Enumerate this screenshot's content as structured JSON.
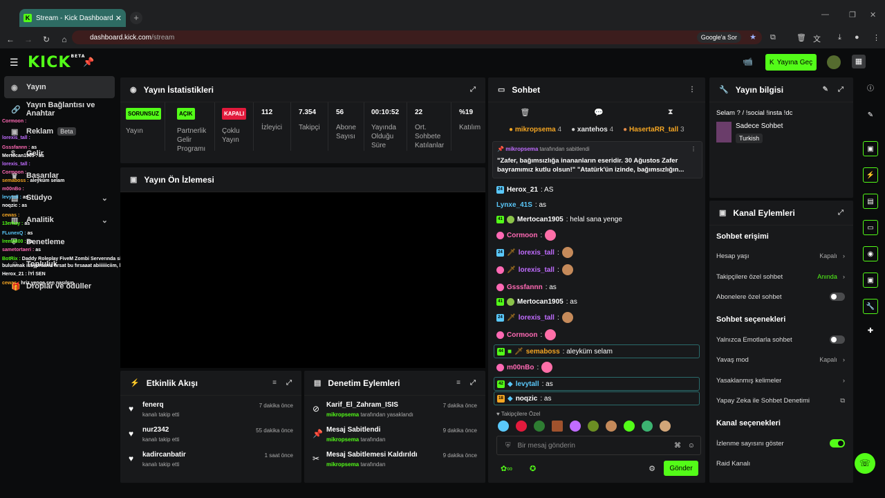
{
  "browser": {
    "tab_title": "Stream - Kick Dashboard",
    "url_host": "dashboard.kick.com",
    "url_path": "/stream",
    "ask_google": "Google'a Sor"
  },
  "top": {
    "logo": "KICK",
    "logo_sup": "BETA",
    "go_live": "Yayına Geç"
  },
  "sidebar": {
    "items": [
      {
        "label": "Yayın"
      },
      {
        "label": "Yayın Bağlantısı ve Anahtar"
      },
      {
        "label": "Reklam",
        "badge": "Beta"
      },
      {
        "label": "Gelir"
      },
      {
        "label": "Başarılar"
      },
      {
        "label": "Stüdyo"
      },
      {
        "label": "Analitik"
      },
      {
        "label": "Denetleme"
      },
      {
        "label": "Topluluk"
      },
      {
        "label": "Droplar ve ödüller"
      }
    ]
  },
  "overlay_chat": [
    {
      "u": "Cormoon :",
      "m": ""
    },
    {
      "u": "lorexis_tall :",
      "m": ""
    },
    {
      "u": "Gsssfannn :",
      "m": "as"
    },
    {
      "u": "Mertocan1905 :",
      "m": "as"
    },
    {
      "u": "lorexis_tall :",
      "m": ""
    },
    {
      "u": "Cormoon :",
      "m": ""
    },
    {
      "u": "semaboss :",
      "m": "aleyküm selam"
    },
    {
      "u": "m00nBo :",
      "m": ""
    },
    {
      "u": "levytall :",
      "m": "as"
    },
    {
      "u": "noqzic :",
      "m": "as"
    },
    {
      "u": "cewas :",
      "m": ""
    },
    {
      "u": "13erkay :",
      "m": "as"
    },
    {
      "u": "FLunexQ :",
      "m": "as"
    },
    {
      "u": "lrem8800 :",
      "m": "as"
    },
    {
      "u": "sametortaeri :",
      "m": "as"
    },
    {
      "u": "BotRix :",
      "m": "Daddy Roleplay FiveM Zombi Serverında sizlerde bizlerle birlikte rol yapma deneyiminde"
    },
    {
      "u": "",
      "m": "bulunmak istiyorsanız fırsat bu fırsaaat abiiiiiiciim, hemen başvurularr açıktır ! https://discord.gg/daddyz"
    },
    {
      "u": "Herox_21 :",
      "m": "İYİ SEN"
    },
    {
      "u": "cewas :",
      "m": "hriz yenge sen nasılsın"
    }
  ],
  "stats": {
    "title": "Yayın İstatistikleri",
    "items": [
      {
        "value": "SORUNSUZ",
        "label": "Yayın",
        "badge": "green"
      },
      {
        "value": "AÇIK",
        "label": "Partnerlik Gelir Programı",
        "badge": "green"
      },
      {
        "value": "KAPALI",
        "label": "Çoklu Yayın",
        "badge": "red"
      },
      {
        "value": "112",
        "label": "İzleyici"
      },
      {
        "value": "7.354",
        "label": "Takipçi"
      },
      {
        "value": "56",
        "label": "Abone Sayısı"
      },
      {
        "value": "00:10:52",
        "label": "Yayında Olduğu Süre"
      },
      {
        "value": "22",
        "label": "Ort. Sohbete Katılanlar"
      },
      {
        "value": "%19",
        "label": "Katılım"
      }
    ]
  },
  "preview": {
    "title": "Yayın Ön İzlemesi"
  },
  "activity": {
    "title": "Etkinlik Akışı",
    "rows": [
      {
        "name": "fenerq",
        "sub": "kanalı takip etti",
        "time": "7 dakika önce"
      },
      {
        "name": "nur2342",
        "sub": "kanalı takip etti",
        "time": "55 dakika önce"
      },
      {
        "name": "kadircanbatir",
        "sub": "kanalı takip etti",
        "time": "1 saat önce"
      }
    ]
  },
  "moderation": {
    "title": "Denetim Eylemleri",
    "rows": [
      {
        "name": "Karif_El_Zahram_ISIS",
        "actor": "mikropsema",
        "sub": "tarafından yasaklandı",
        "time": "7 dakika önce"
      },
      {
        "name": "Mesaj Sabitlendi",
        "actor": "mikropsema",
        "sub": "tarafından",
        "time": "9 dakika önce"
      },
      {
        "name": "Mesaj Sabitlemesi Kaldırıldı",
        "actor": "mikropsema",
        "sub": "tarafından",
        "time": "9 dakika önce"
      }
    ]
  },
  "chat": {
    "title": "Sohbet",
    "top_chatters": [
      {
        "name": "mikropsema",
        "count": "4",
        "color": "#f5a623"
      },
      {
        "name": "xantehos",
        "count": "4",
        "color": "#ffffff"
      },
      {
        "name": "HasertaRR_tall",
        "count": "3",
        "color": "#f5a623"
      }
    ],
    "pinned_by": "mikropsema",
    "pinned_suffix": "tarafından sabitlendi",
    "pinned_text": "\"Zafer, bağımsızlığa inananların eseridir. 30 Ağustos Zafer bayramımız kutlu olsun!\" \"Atatürk'ün izinde, bağımsızlığın...",
    "messages": [
      {
        "user": "Herox_21",
        "text": ": AS",
        "color": "#ffffff",
        "lvl": "24",
        "hl": false
      },
      {
        "user": "Lynxe_41S",
        "text": ": as",
        "color": "#5ac8fa",
        "lvl": "",
        "hl": false
      },
      {
        "user": "Mertocan1905",
        "text": ": helal sana yenge",
        "color": "#ffffff",
        "lvl": "41",
        "hl": false
      },
      {
        "user": "Cormoon",
        "text": ":",
        "color": "#ff69b4",
        "lvl": "",
        "hl": false
      },
      {
        "user": "lorexis_tall",
        "text": ":",
        "color": "#c06cff",
        "lvl": "24",
        "hl": false
      },
      {
        "user": "lorexis_tall",
        "text": ":",
        "color": "#c06cff",
        "lvl": "",
        "hl": false
      },
      {
        "user": "Gsssfannn",
        "text": ": as",
        "color": "#ff69b4",
        "lvl": "",
        "hl": false
      },
      {
        "user": "Mertocan1905",
        "text": ": as",
        "color": "#ffffff",
        "lvl": "41",
        "hl": false
      },
      {
        "user": "lorexis_tall",
        "text": ":",
        "color": "#c06cff",
        "lvl": "24",
        "hl": false
      },
      {
        "user": "Cormoon",
        "text": ":",
        "color": "#ff69b4",
        "lvl": "",
        "hl": false
      },
      {
        "user": "semaboss",
        "text": ": aleyküm selam",
        "color": "#f5a623",
        "lvl": "44",
        "hl": true
      },
      {
        "user": "m00nBo",
        "text": ":",
        "color": "#ff69b4",
        "lvl": "",
        "hl": false
      },
      {
        "user": "levytall",
        "text": ": as",
        "color": "#5ac8fa",
        "lvl": "42",
        "hl": true
      },
      {
        "user": "noqzic",
        "text": ": as",
        "color": "#ffffff",
        "lvl": "18",
        "hl": true
      }
    ],
    "followers_only": "Takipçilere Özel",
    "input_placeholder": "Bir mesaj gönderin",
    "send": "Gönder"
  },
  "stream_info": {
    "title": "Yayın bilgisi",
    "stream_title": "Selam ? / !social !insta !dc",
    "category": "Sadece Sohbet",
    "language": "Turkish"
  },
  "channel_actions": {
    "title": "Kanal Eylemleri",
    "chat_access": "Sohbet erişimi",
    "account_age": {
      "label": "Hesap yaşı",
      "value": "Kapalı"
    },
    "followers_only": {
      "label": "Takipçilere özel sohbet",
      "value": "Anında"
    },
    "subs_only": {
      "label": "Abonelere özel sohbet"
    },
    "chat_options": "Sohbet seçenekleri",
    "emotes_only": {
      "label": "Yalnızca Emotlarla sohbet"
    },
    "slow_mode": {
      "label": "Yavaş mod",
      "value": "Kapalı"
    },
    "banned_words": {
      "label": "Yasaklanmış kelimeler"
    },
    "ai_moderation": {
      "label": "Yapay Zeka ile Sohbet Denetimi"
    },
    "channel_options": "Kanal seçenekleri",
    "show_viewers": {
      "label": "İzlenme sayısını göster"
    },
    "raid": {
      "label": "Raid Kanalı"
    }
  },
  "colors": {
    "accent": "#53fc18",
    "panel": "#18191b",
    "bg": "#0b0c0d"
  }
}
